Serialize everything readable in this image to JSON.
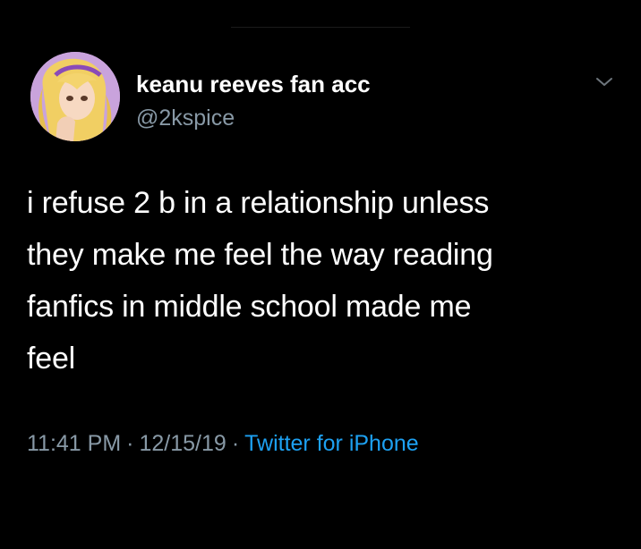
{
  "tweet": {
    "author": {
      "display_name": "keanu reeves fan acc",
      "handle": "@2kspice",
      "avatar_icon": "cartoon-avatar"
    },
    "menu_icon": "chevron-down-icon",
    "text_lines": [
      "i refuse 2 b in a relationship unless",
      "they make me feel the way reading",
      "fanfics in middle school made me",
      "feel"
    ],
    "time": "11:41 PM",
    "separator": "·",
    "date": "12/15/19",
    "source": "Twitter for iPhone"
  },
  "colors": {
    "background": "#000000",
    "primary_text": "#ffffff",
    "secondary_text": "#8899a6",
    "link": "#1da1f2"
  }
}
